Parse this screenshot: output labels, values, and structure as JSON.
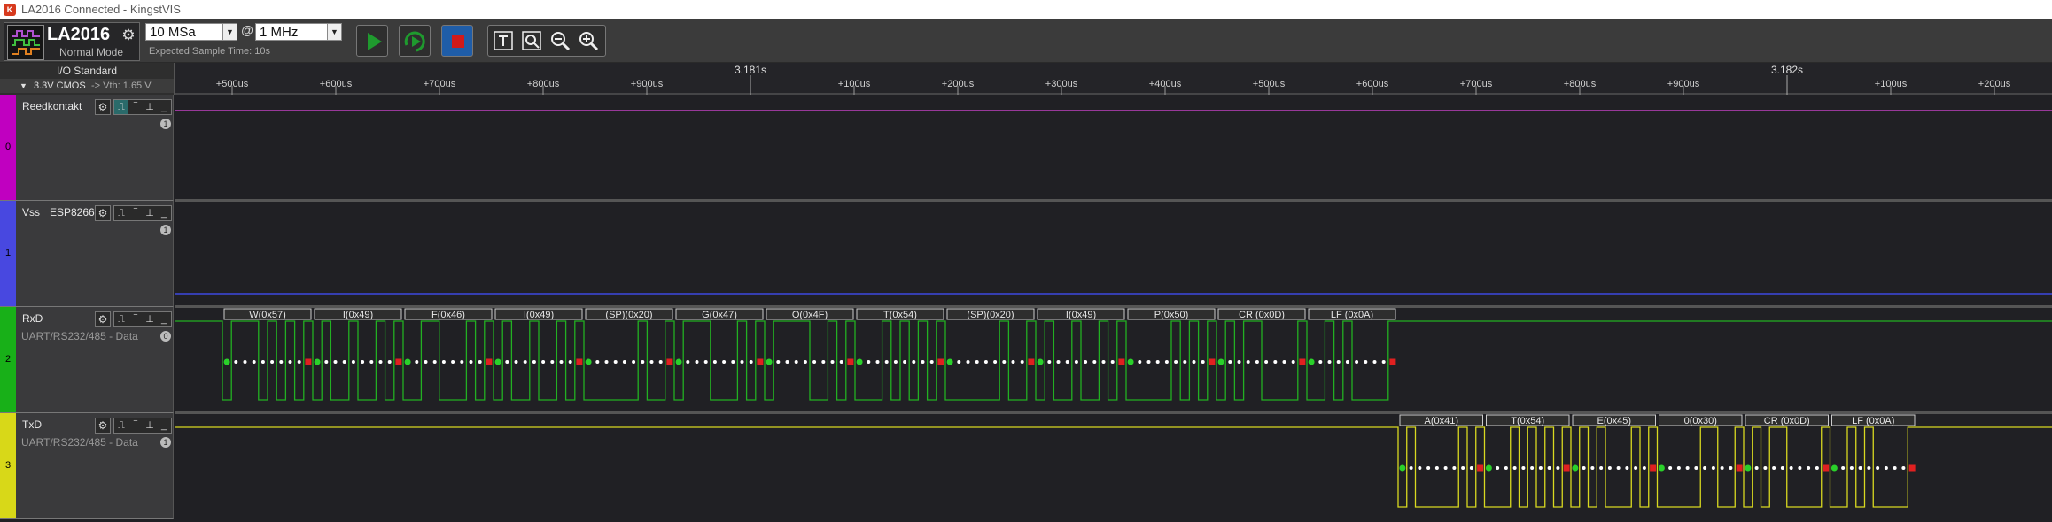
{
  "window": {
    "title": "LA2016 Connected - KingstVIS",
    "icon_label": "K"
  },
  "device": {
    "name": "LA2016",
    "mode": "Normal Mode",
    "settings_icon": "gear-icon"
  },
  "sampling": {
    "rate": "10 MSa",
    "at": "@",
    "depth": "1 MHz",
    "expected": "Expected Sample Time: 10s"
  },
  "toolbar": {
    "start_icon": "play-icon",
    "repeat_icon": "repeat-play-icon",
    "stop_icon": "stop-icon",
    "text_icon": "text-cursor-icon",
    "zoom_fit_icon": "zoom-fit-icon",
    "zoom_out_icon": "zoom-out-icon",
    "zoom_in_icon": "zoom-in-icon",
    "colors": {
      "start": "#1f9a2e",
      "stop": "#d11a1a",
      "stop_bg": "#1f5da8"
    }
  },
  "io": {
    "label": "I/O Standard",
    "standard": "3.3V CMOS",
    "vth": "-> Vth: 1.65 V"
  },
  "timebar": {
    "major": [
      {
        "label": "3.181s",
        "t": 0.0
      },
      {
        "label": "3.182s",
        "t": 1000
      }
    ],
    "minor": [
      {
        "label": "+500us",
        "t": -500
      },
      {
        "label": "+600us",
        "t": -400
      },
      {
        "label": "+700us",
        "t": -300
      },
      {
        "label": "+800us",
        "t": -200
      },
      {
        "label": "+900us",
        "t": -100
      },
      {
        "label": "+100us",
        "t": 100
      },
      {
        "label": "+200us",
        "t": 200
      },
      {
        "label": "+300us",
        "t": 300
      },
      {
        "label": "+400us",
        "t": 400
      },
      {
        "label": "+500us",
        "t": 500
      },
      {
        "label": "+600us",
        "t": 600
      },
      {
        "label": "+700us",
        "t": 700
      },
      {
        "label": "+800us",
        "t": 800
      },
      {
        "label": "+900us",
        "t": 900
      },
      {
        "label": "+100us",
        "t": 1100
      },
      {
        "label": "+200us",
        "t": 1200
      }
    ]
  },
  "channels": [
    {
      "num": "0",
      "name": "Reedkontakt",
      "sub": "",
      "proto": "",
      "badge": "1",
      "color": "#c000c0",
      "line": "#c040c0",
      "level": "high"
    },
    {
      "num": "1",
      "name": "Vss",
      "sub": "ESP8266",
      "proto": "",
      "badge": "1",
      "color": "#4848e0",
      "line": "#3c48e0",
      "level": "low"
    },
    {
      "num": "2",
      "name": "RxD",
      "sub": "",
      "proto": "UART/RS232/485 - Data",
      "badge": "0",
      "color": "#18b018",
      "line": "#22b022"
    },
    {
      "num": "3",
      "name": "TxD",
      "sub": "",
      "proto": "UART/RS232/485 - Data",
      "badge": "1",
      "color": "#d8d818",
      "line": "#d8d820"
    }
  ],
  "rx_frames": [
    "W(0x57)",
    "I(0x49)",
    "F(0x46)",
    "I(0x49)",
    "(SP)(0x20)",
    "G(0x47)",
    "O(0x4F)",
    "T(0x54)",
    "(SP)(0x20)",
    "I(0x49)",
    "P(0x50)",
    "CR (0x0D)",
    "LF (0x0A)"
  ],
  "rx_codes": [
    87,
    73,
    70,
    73,
    32,
    71,
    79,
    84,
    32,
    73,
    80,
    13,
    10
  ],
  "tx_frames": [
    "A(0x41)",
    "T(0x54)",
    "E(0x45)",
    "0(0x30)",
    "CR (0x0D)",
    "LF (0x0A)"
  ],
  "tx_codes": [
    65,
    84,
    69,
    48,
    13,
    10
  ]
}
